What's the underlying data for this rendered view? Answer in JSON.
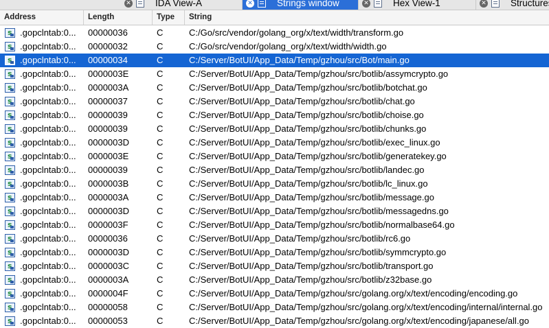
{
  "tabs": [
    {
      "label": "IDA View-A",
      "icon": "text-view-icon",
      "active": false
    },
    {
      "label": "Strings window",
      "icon": "strings-icon",
      "active": true
    },
    {
      "label": "Hex View-1",
      "icon": "hex-icon",
      "active": false
    },
    {
      "label": "Structures",
      "icon": "structures-icon",
      "active": false
    }
  ],
  "columns": {
    "address": "Address",
    "length": "Length",
    "type": "Type",
    "string": "String"
  },
  "selected_row": 2,
  "colors": {
    "selection": "#1565d3",
    "active_tab": "#2b6fd8"
  },
  "rows": [
    {
      "address": ".gopclntab:0...",
      "length": "00000036",
      "type": "C",
      "string": "C:/Go/src/vendor/golang_org/x/text/width/transform.go"
    },
    {
      "address": ".gopclntab:0...",
      "length": "00000032",
      "type": "C",
      "string": "C:/Go/src/vendor/golang_org/x/text/width/width.go"
    },
    {
      "address": ".gopclntab:0...",
      "length": "00000034",
      "type": "C",
      "string": "C:/Server/BotUI/App_Data/Temp/gzhou/src/Bot/main.go"
    },
    {
      "address": ".gopclntab:0...",
      "length": "0000003E",
      "type": "C",
      "string": "C:/Server/BotUI/App_Data/Temp/gzhou/src/botlib/assymcrypto.go"
    },
    {
      "address": ".gopclntab:0...",
      "length": "0000003A",
      "type": "C",
      "string": "C:/Server/BotUI/App_Data/Temp/gzhou/src/botlib/botchat.go"
    },
    {
      "address": ".gopclntab:0...",
      "length": "00000037",
      "type": "C",
      "string": "C:/Server/BotUI/App_Data/Temp/gzhou/src/botlib/chat.go"
    },
    {
      "address": ".gopclntab:0...",
      "length": "00000039",
      "type": "C",
      "string": "C:/Server/BotUI/App_Data/Temp/gzhou/src/botlib/choise.go"
    },
    {
      "address": ".gopclntab:0...",
      "length": "00000039",
      "type": "C",
      "string": "C:/Server/BotUI/App_Data/Temp/gzhou/src/botlib/chunks.go"
    },
    {
      "address": ".gopclntab:0...",
      "length": "0000003D",
      "type": "C",
      "string": "C:/Server/BotUI/App_Data/Temp/gzhou/src/botlib/exec_linux.go"
    },
    {
      "address": ".gopclntab:0...",
      "length": "0000003E",
      "type": "C",
      "string": "C:/Server/BotUI/App_Data/Temp/gzhou/src/botlib/generatekey.go"
    },
    {
      "address": ".gopclntab:0...",
      "length": "00000039",
      "type": "C",
      "string": "C:/Server/BotUI/App_Data/Temp/gzhou/src/botlib/landec.go"
    },
    {
      "address": ".gopclntab:0...",
      "length": "0000003B",
      "type": "C",
      "string": "C:/Server/BotUI/App_Data/Temp/gzhou/src/botlib/lc_linux.go"
    },
    {
      "address": ".gopclntab:0...",
      "length": "0000003A",
      "type": "C",
      "string": "C:/Server/BotUI/App_Data/Temp/gzhou/src/botlib/message.go"
    },
    {
      "address": ".gopclntab:0...",
      "length": "0000003D",
      "type": "C",
      "string": "C:/Server/BotUI/App_Data/Temp/gzhou/src/botlib/messagedns.go"
    },
    {
      "address": ".gopclntab:0...",
      "length": "0000003F",
      "type": "C",
      "string": "C:/Server/BotUI/App_Data/Temp/gzhou/src/botlib/normalbase64.go"
    },
    {
      "address": ".gopclntab:0...",
      "length": "00000036",
      "type": "C",
      "string": "C:/Server/BotUI/App_Data/Temp/gzhou/src/botlib/rc6.go"
    },
    {
      "address": ".gopclntab:0...",
      "length": "0000003D",
      "type": "C",
      "string": "C:/Server/BotUI/App_Data/Temp/gzhou/src/botlib/symmcrypto.go"
    },
    {
      "address": ".gopclntab:0...",
      "length": "0000003C",
      "type": "C",
      "string": "C:/Server/BotUI/App_Data/Temp/gzhou/src/botlib/transport.go"
    },
    {
      "address": ".gopclntab:0...",
      "length": "0000003A",
      "type": "C",
      "string": "C:/Server/BotUI/App_Data/Temp/gzhou/src/botlib/z32base.go"
    },
    {
      "address": ".gopclntab:0...",
      "length": "0000004F",
      "type": "C",
      "string": "C:/Server/BotUI/App_Data/Temp/gzhou/src/golang.org/x/text/encoding/encoding.go"
    },
    {
      "address": ".gopclntab:0...",
      "length": "00000058",
      "type": "C",
      "string": "C:/Server/BotUI/App_Data/Temp/gzhou/src/golang.org/x/text/encoding/internal/internal.go"
    },
    {
      "address": ".gopclntab:0...",
      "length": "00000053",
      "type": "C",
      "string": "C:/Server/BotUI/App_Data/Temp/gzhou/src/golang.org/x/text/encoding/japanese/all.go"
    }
  ]
}
